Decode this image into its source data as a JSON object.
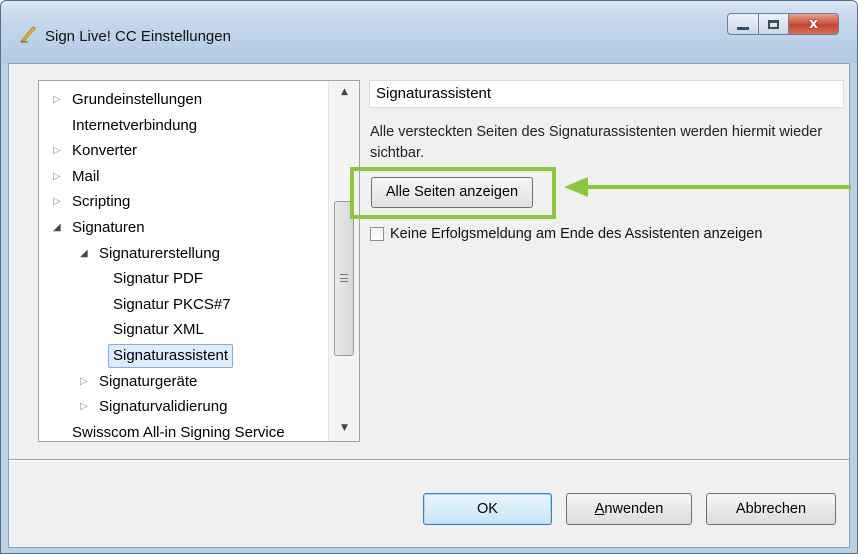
{
  "window": {
    "title": "Sign Live! CC Einstellungen",
    "close_glyph": "x"
  },
  "tree": {
    "items": [
      {
        "label": "Grundeinstellungen",
        "level": 0,
        "expander": "collapsed"
      },
      {
        "label": "Internetverbindung",
        "level": 0,
        "expander": "none"
      },
      {
        "label": "Konverter",
        "level": 0,
        "expander": "collapsed"
      },
      {
        "label": "Mail",
        "level": 0,
        "expander": "collapsed"
      },
      {
        "label": "Scripting",
        "level": 0,
        "expander": "collapsed"
      },
      {
        "label": "Signaturen",
        "level": 0,
        "expander": "expanded"
      },
      {
        "label": "Signaturerstellung",
        "level": 1,
        "expander": "expanded"
      },
      {
        "label": "Signatur PDF",
        "level": 2,
        "expander": "none"
      },
      {
        "label": "Signatur PKCS#7",
        "level": 2,
        "expander": "none"
      },
      {
        "label": "Signatur XML",
        "level": 2,
        "expander": "none"
      },
      {
        "label": "Signaturassistent",
        "level": 2,
        "expander": "none",
        "selected": true
      },
      {
        "label": "Signaturgeräte",
        "level": 1,
        "expander": "collapsed"
      },
      {
        "label": "Signaturvalidierung",
        "level": 1,
        "expander": "collapsed"
      },
      {
        "label": "Swisscom All-in Signing Service",
        "level": 0,
        "expander": "none"
      }
    ]
  },
  "panel": {
    "heading": "Signaturassistent",
    "description": "Alle versteckten Seiten des Signaturassistenten werden hiermit wieder sichtbar.",
    "show_all_label": "Alle Seiten anzeigen",
    "checkbox_label": "Keine Erfolgsmeldung am Ende des Assistenten anzeigen",
    "checkbox_checked": false
  },
  "buttons": {
    "ok": "OK",
    "apply": "Anwenden",
    "cancel": "Abbrechen"
  },
  "colors": {
    "highlight": "#8cc63f",
    "selection_bg": "#ddecfb",
    "selection_border": "#84acdd"
  }
}
